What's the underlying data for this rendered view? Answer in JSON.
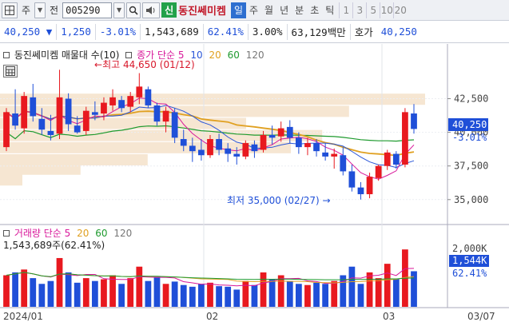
{
  "toolbar": {
    "market_label": "주",
    "period_label": "전",
    "stock_code": "005290",
    "new_badge": "신",
    "stock_name": "동진쎄미켐",
    "periods": [
      "일",
      "주",
      "월",
      "년",
      "분",
      "초",
      "틱"
    ],
    "selected_period": "일",
    "numbers": [
      "1",
      "3",
      "5",
      "10",
      "20"
    ]
  },
  "quote": {
    "price": "40,250",
    "change": "1,250",
    "change_pct": "-3.01%",
    "volume": "1,543,689",
    "turnover_ratio": "62.41%",
    "extra_pct": "3.00%",
    "amount": "63,129백만",
    "ask_label": "호가",
    "ask_price": "40,250"
  },
  "price_chart": {
    "title": "동진쎄미켐 매물대 수(10)",
    "ma_legend_label": "종가 단순",
    "ma_periods": [
      "5",
      "10",
      "20",
      "60",
      "120"
    ],
    "ma_colors": [
      "#d8189a",
      "#2a56d8",
      "#e0a020",
      "#1e9a2e",
      "#777777"
    ],
    "high_label": "최고 44,650 (01/12)",
    "low_label": "최저 35,000 (02/27)",
    "y_ticks": [
      "42,500",
      "40,000",
      "37,500",
      "35,000"
    ],
    "current_price_tag": "40,250",
    "current_change_tag": "-3.01%"
  },
  "volume_chart": {
    "title": "거래량 단순",
    "ma_periods": [
      "5",
      "20",
      "60",
      "120"
    ],
    "value_label": "1,543,689주(62.41%)",
    "y_ticks": [
      "2,000K",
      "1,544K",
      "62.41%"
    ]
  },
  "x_axis": [
    "2024/01",
    "02",
    "03",
    "03/07"
  ],
  "colors": {
    "up": "#e8191f",
    "down": "#1f4fd8",
    "ma5": "#d8189a",
    "ma10": "#2a56d8",
    "ma20": "#e0a020",
    "ma60": "#1e9a2e"
  },
  "chart_data": {
    "type": "candlestick",
    "title": "동진쎄미켐 매물대 수(10)",
    "y_range": [
      33800,
      45500
    ],
    "candles": [
      {
        "o": 38900,
        "h": 41800,
        "l": 38600,
        "c": 41500
      },
      {
        "o": 41400,
        "h": 43200,
        "l": 40200,
        "c": 40500
      },
      {
        "o": 40300,
        "h": 43000,
        "l": 39900,
        "c": 42700
      },
      {
        "o": 42600,
        "h": 43600,
        "l": 40800,
        "c": 41200
      },
      {
        "o": 41000,
        "h": 41800,
        "l": 39800,
        "c": 40200
      },
      {
        "o": 40100,
        "h": 41300,
        "l": 39400,
        "c": 39800
      },
      {
        "o": 39900,
        "h": 44650,
        "l": 39500,
        "c": 42600
      },
      {
        "o": 42500,
        "h": 42900,
        "l": 40100,
        "c": 40600
      },
      {
        "o": 40500,
        "h": 41200,
        "l": 39900,
        "c": 40000
      },
      {
        "o": 40100,
        "h": 41900,
        "l": 39800,
        "c": 41600
      },
      {
        "o": 41500,
        "h": 42300,
        "l": 40900,
        "c": 41300
      },
      {
        "o": 41400,
        "h": 42600,
        "l": 40900,
        "c": 42200
      },
      {
        "o": 42000,
        "h": 43200,
        "l": 41600,
        "c": 42600
      },
      {
        "o": 42400,
        "h": 42700,
        "l": 41500,
        "c": 41800
      },
      {
        "o": 41900,
        "h": 43000,
        "l": 41500,
        "c": 42700
      },
      {
        "o": 42600,
        "h": 44400,
        "l": 42100,
        "c": 43400
      },
      {
        "o": 43200,
        "h": 43400,
        "l": 41800,
        "c": 42000
      },
      {
        "o": 42000,
        "h": 42200,
        "l": 40500,
        "c": 40800
      },
      {
        "o": 40800,
        "h": 41900,
        "l": 40000,
        "c": 41600
      },
      {
        "o": 41500,
        "h": 41800,
        "l": 39200,
        "c": 39600
      },
      {
        "o": 39500,
        "h": 40200,
        "l": 38600,
        "c": 39000
      },
      {
        "o": 39000,
        "h": 39600,
        "l": 37800,
        "c": 38600
      },
      {
        "o": 38700,
        "h": 39500,
        "l": 37900,
        "c": 38300
      },
      {
        "o": 38300,
        "h": 39800,
        "l": 38100,
        "c": 39500
      },
      {
        "o": 39500,
        "h": 39900,
        "l": 38300,
        "c": 38700
      },
      {
        "o": 38800,
        "h": 39200,
        "l": 37800,
        "c": 38400
      },
      {
        "o": 38400,
        "h": 38900,
        "l": 37600,
        "c": 38200
      },
      {
        "o": 38200,
        "h": 39400,
        "l": 38000,
        "c": 39200
      },
      {
        "o": 39100,
        "h": 39400,
        "l": 38100,
        "c": 38600
      },
      {
        "o": 38700,
        "h": 40100,
        "l": 38500,
        "c": 39800
      },
      {
        "o": 39800,
        "h": 40500,
        "l": 39100,
        "c": 39600
      },
      {
        "o": 39700,
        "h": 40800,
        "l": 39300,
        "c": 40300
      },
      {
        "o": 40400,
        "h": 40900,
        "l": 39200,
        "c": 39600
      },
      {
        "o": 39600,
        "h": 40000,
        "l": 38400,
        "c": 38900
      },
      {
        "o": 38900,
        "h": 39600,
        "l": 38300,
        "c": 39200
      },
      {
        "o": 39200,
        "h": 39500,
        "l": 38200,
        "c": 38600
      },
      {
        "o": 38500,
        "h": 39200,
        "l": 37900,
        "c": 38200
      },
      {
        "o": 38200,
        "h": 38800,
        "l": 37300,
        "c": 38400
      },
      {
        "o": 38300,
        "h": 38900,
        "l": 36800,
        "c": 37100
      },
      {
        "o": 37100,
        "h": 37600,
        "l": 35600,
        "c": 35900
      },
      {
        "o": 35900,
        "h": 36300,
        "l": 35000,
        "c": 35400
      },
      {
        "o": 35400,
        "h": 37000,
        "l": 35100,
        "c": 36700
      },
      {
        "o": 36600,
        "h": 37600,
        "l": 36400,
        "c": 37500
      },
      {
        "o": 37500,
        "h": 38700,
        "l": 37200,
        "c": 38500
      },
      {
        "o": 38400,
        "h": 38600,
        "l": 37300,
        "c": 37600
      },
      {
        "o": 37600,
        "h": 41800,
        "l": 37400,
        "c": 41500
      },
      {
        "o": 41400,
        "h": 42100,
        "l": 39900,
        "c": 40250
      }
    ],
    "volume": [
      55,
      60,
      65,
      50,
      40,
      45,
      85,
      60,
      42,
      50,
      45,
      48,
      55,
      40,
      50,
      70,
      45,
      52,
      40,
      44,
      38,
      35,
      40,
      42,
      36,
      35,
      30,
      45,
      38,
      60,
      48,
      55,
      45,
      40,
      38,
      42,
      40,
      45,
      55,
      70,
      40,
      60,
      50,
      75,
      48,
      100,
      62
    ]
  }
}
